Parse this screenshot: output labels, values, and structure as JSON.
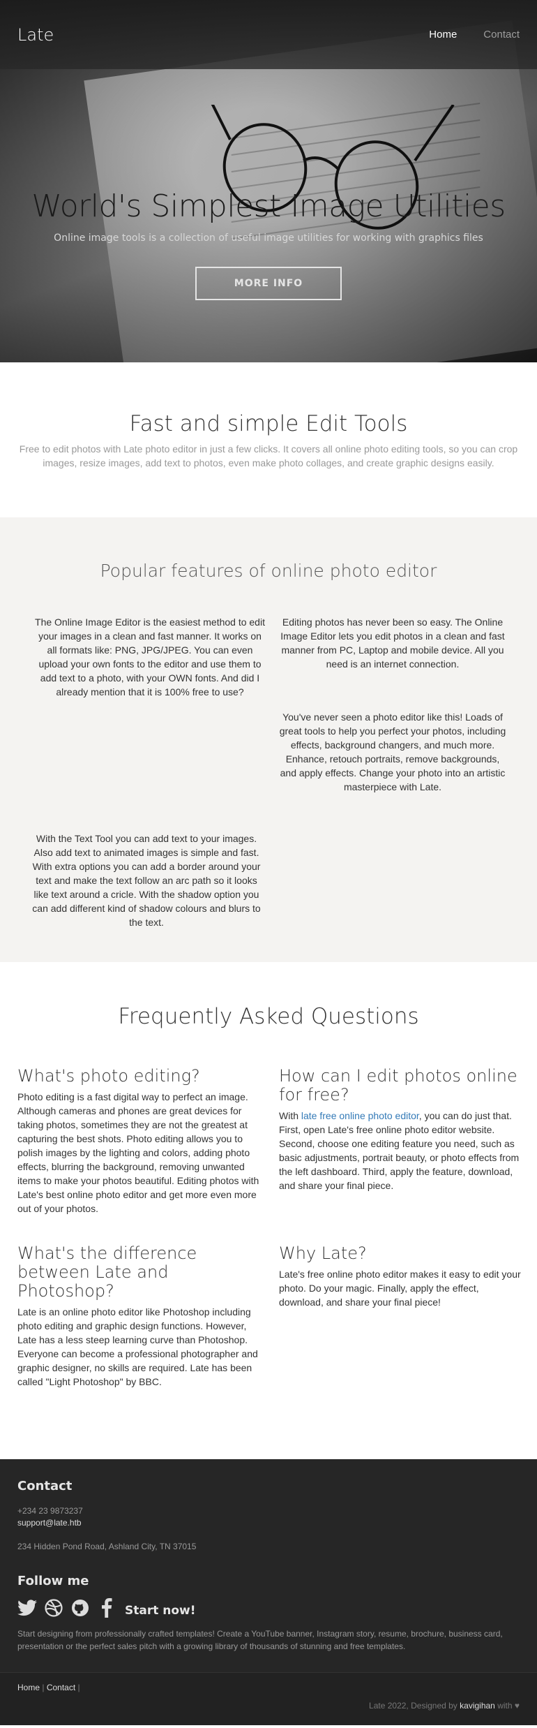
{
  "nav": {
    "brand": "Late",
    "links": [
      {
        "label": "Home",
        "active": true
      },
      {
        "label": "Contact",
        "active": false
      }
    ]
  },
  "hero": {
    "title": "World's Simplest Image Utilities",
    "subtitle": "Online image tools is a collection of useful image utilities for working with graphics files",
    "button": "MORE INFO"
  },
  "tools": {
    "title": "Fast and simple Edit Tools",
    "text": "Free to edit photos with Late photo editor in just a few clicks. It covers all online photo editing tools, so you can crop images, resize images, add text to photos, even make photo collages, and create graphic designs easily."
  },
  "features": {
    "title": "Popular features of online photo editor",
    "items": [
      "The Online Image Editor is the easiest method to edit your images in a clean and fast manner. It works on all formats like: PNG, JPG/JPEG. You can even upload your own fonts to the editor and use them to add text to a photo, with your OWN fonts. And did I already mention that it is 100% free to use?",
      "Editing photos has never been so easy. The Online Image Editor lets you edit photos in a clean and fast manner from PC, Laptop and mobile device. All you need is an internet connection.",
      "You've never seen a photo editor like this! Loads of great tools to help you perfect your photos, including effects, background changers, and much more. Enhance, retouch portraits, remove backgrounds, and apply effects. Change your photo into an artistic masterpiece with Late.",
      "With the Text Tool you can add text to your images. Also add text to animated images is simple and fast. With extra options you can add a border around your text and make the text follow an arc path so it looks like text around a cricle. With the shadow option you can add different kind of shadow colours and blurs to the text."
    ]
  },
  "faq": {
    "title": "Frequently Asked Questions",
    "q1": {
      "q": "What's photo editing?",
      "a": "Photo editing is a fast digital way to perfect an image. Although cameras and phones are great devices for taking photos, sometimes they are not the greatest at capturing the best shots. Photo editing allows you to polish images by the lighting and colors, adding photo effects, blurring the background, removing unwanted items to make your photos beautiful. Editing photos with Late's best online photo editor and get more even more out of your photos."
    },
    "q2": {
      "q": "How can I edit photos online for free?",
      "a_prefix": "With ",
      "a_link": "late free online photo editor",
      "a_suffix": ", you can do just that. First, open Late's free online photo editor website. Second, choose one editing feature you need, such as basic adjustments, portrait beauty, or photo effects from the left dashboard. Third, apply the feature, download, and share your final piece."
    },
    "q3": {
      "q": "What's the difference between Late and Photoshop?",
      "a": "Late is an online photo editor like Photoshop including photo editing and graphic design functions. However, Late has a less steep learning curve than Photoshop. Everyone can become a professional photographer and graphic designer, no skills are required. Late has been called \"Light Photoshop\" by BBC."
    },
    "q4": {
      "q": "Why Late?",
      "a": "Late's free online photo editor makes it easy to edit your photo. Do your magic. Finally, apply the effect, download, and share your final piece!"
    }
  },
  "footer": {
    "contact_title": "Contact",
    "phone": "+234 23 9873237",
    "email": "support@late.htb",
    "address": "234 Hidden Pond Road, Ashland City, TN 37015",
    "follow_title": "Follow me",
    "socials": [
      "twitter-icon",
      "dribbble-icon",
      "github-icon",
      "facebook-icon"
    ],
    "start_now": "Start now!",
    "description": "Start designing from professionally crafted templates! Create a YouTube banner, Instagram story, resume, brochure, business card, presentation or the perfect sales pitch with a growing library of thousands of stunning and free templates.",
    "bottom_links": [
      "Home",
      "Contact"
    ],
    "copyright_prefix": "Late 2022, Designed by ",
    "author": "kavigihan",
    "copyright_suffix": " with ♥"
  }
}
